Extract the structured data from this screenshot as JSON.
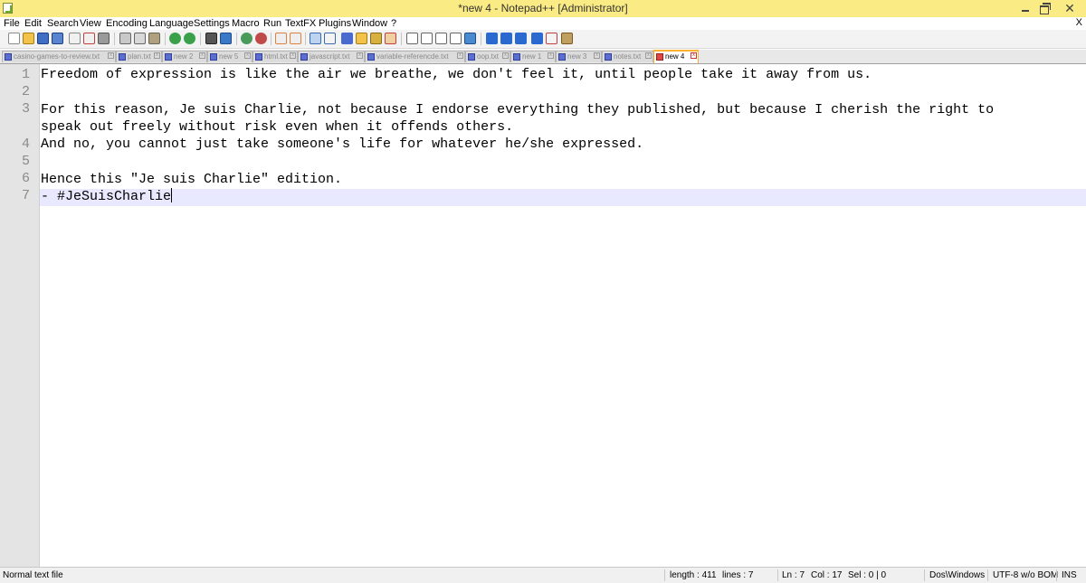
{
  "window": {
    "title": "*new  4 - Notepad++ [Administrator]",
    "close_menu_glyph": "X",
    "minimize_icon": "minimize-icon",
    "maximize_icon": "restore-icon",
    "close_glyph": "✕"
  },
  "menu": [
    "File",
    "Edit",
    "Search",
    "View",
    "Encoding",
    "Language",
    "Settings",
    "Macro",
    "Run",
    "TextFX",
    "Plugins",
    "Window",
    "?"
  ],
  "toolbar_icons": [
    "new-file-icon",
    "open-file-icon",
    "save-icon",
    "save-all-icon",
    "close-icon",
    "close-all-icon",
    "print-icon",
    "cut-icon",
    "copy-icon",
    "paste-icon",
    "undo-icon",
    "redo-icon",
    "find-icon",
    "replace-icon",
    "zoom-in-icon",
    "zoom-out-icon",
    "sync-vertical-icon",
    "sync-horizontal-icon",
    "word-wrap-icon",
    "show-all-chars-icon",
    "indent-guide-icon",
    "folder-as-workspace-icon",
    "document-map-icon",
    "function-list-icon",
    "record-macro-icon",
    "stop-record-icon",
    "play-macro-icon",
    "play-multiple-icon",
    "save-macro-icon",
    "move-up-icon",
    "move-down-icon",
    "sort-icon",
    "spellcheck-icon",
    "plugin-icon"
  ],
  "tabs": [
    {
      "label": "casino-games-to-review.txt",
      "active": false
    },
    {
      "label": "plan.txt",
      "active": false
    },
    {
      "label": "new  2",
      "active": false
    },
    {
      "label": "new  5",
      "active": false
    },
    {
      "label": "html.txt",
      "active": false
    },
    {
      "label": "javascript.txt",
      "active": false
    },
    {
      "label": "variable-referencde.txt",
      "active": false
    },
    {
      "label": "oop.txt",
      "active": false
    },
    {
      "label": "new  1",
      "active": false
    },
    {
      "label": "new  3",
      "active": false
    },
    {
      "label": "notes.txt",
      "active": false
    },
    {
      "label": "new  4",
      "active": true
    }
  ],
  "editor": {
    "line_numbers": [
      "1",
      "2",
      "3",
      "4",
      "5",
      "6",
      "7"
    ],
    "lines": [
      "Freedom of expression is like the air we breathe, we don't feel it, until people take it away from us.",
      "",
      "For this reason, Je suis Charlie, not because I endorse everything they published, but because I cherish the right to",
      "speak out freely without risk even when it offends others.",
      "And no, you cannot just take someone's life for whatever he/she expressed.",
      "",
      "Hence this \"Je suis Charlie\" edition.",
      "- #JeSuisCharlie"
    ]
  },
  "status": {
    "file_type": "Normal text file",
    "length": "length : 411",
    "lines": "lines : 7",
    "ln": "Ln : 7",
    "col": "Col : 17",
    "sel": "Sel : 0 | 0",
    "eol": "Dos\\Windows",
    "encoding": "UTF-8 w/o BOM",
    "mode": "INS"
  }
}
